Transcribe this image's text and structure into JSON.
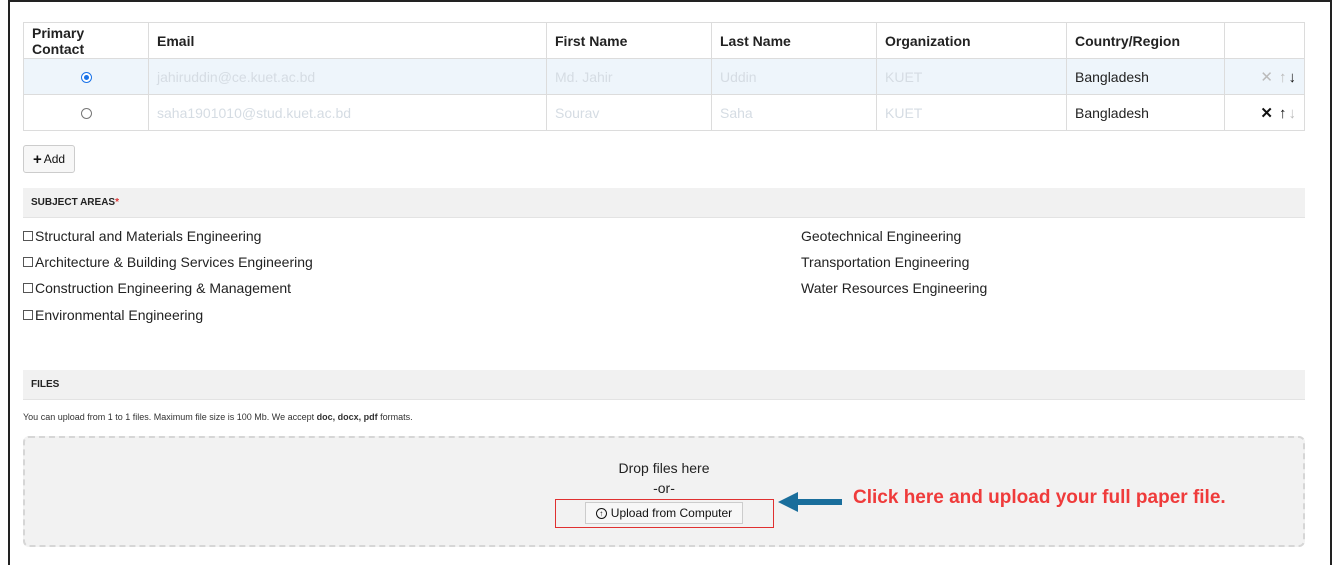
{
  "authors_table": {
    "headers": [
      "Primary Contact",
      "Email",
      "First Name",
      "Last Name",
      "Organization",
      "Country/Region"
    ],
    "rows": [
      {
        "primary": true,
        "email": "jahiruddin@ce.kuet.ac.bd",
        "first_name": "Md. Jahir",
        "last_name": "Uddin",
        "organization": "KUET",
        "country": "Bangladesh"
      },
      {
        "primary": false,
        "email": "saha1901010@stud.kuet.ac.bd",
        "first_name": "Sourav",
        "last_name": "Saha",
        "organization": "KUET",
        "country": "Bangladesh"
      }
    ]
  },
  "add_button": {
    "label": "Add"
  },
  "subject_areas": {
    "title": "SUBJECT AREAS",
    "required_mark": "*",
    "left": [
      "Structural and Materials Engineering",
      "Architecture & Building Services Engineering",
      "Construction Engineering & Management",
      "Environmental Engineering"
    ],
    "right": [
      "Geotechnical Engineering",
      "Transportation Engineering",
      "Water Resources Engineering"
    ]
  },
  "files": {
    "title": "FILES",
    "note_prefix": "You can upload from 1 to 1 files. Maximum file size is 100 Mb. We accept ",
    "note_formats": "doc, docx, pdf",
    "note_suffix": " formats.",
    "drop_text": "Drop files here",
    "or_text": "-or-",
    "upload_label": "Upload from Computer"
  },
  "callout": {
    "text": "Click here and upload your full paper file.",
    "arrow_color": "#1a6e9c",
    "text_color": "#ef3b3b"
  }
}
